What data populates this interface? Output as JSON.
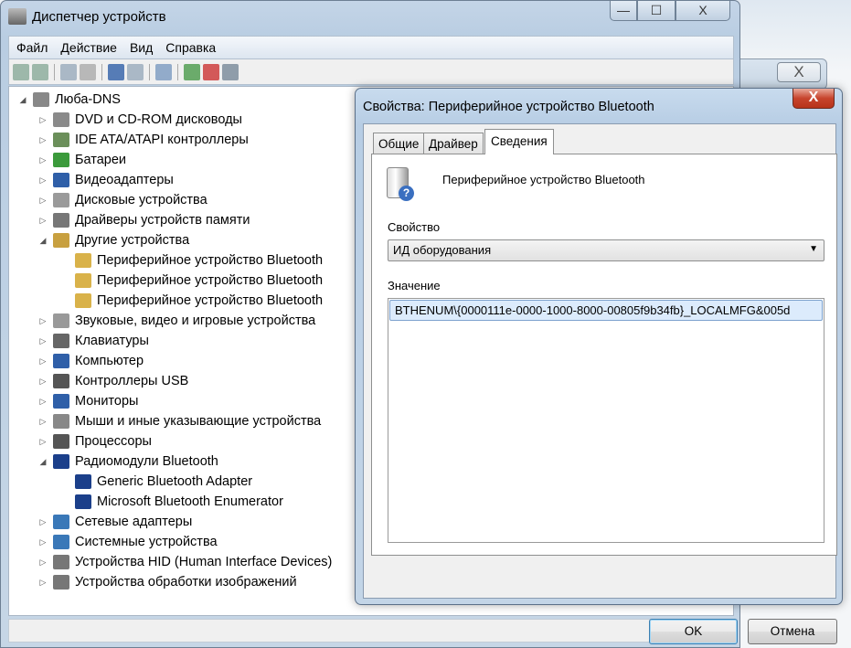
{
  "main_window": {
    "title": "Диспетчер устройств",
    "minimize": "—",
    "maximize": "☐",
    "close": "X"
  },
  "menu": [
    "Файл",
    "Действие",
    "Вид",
    "Справка"
  ],
  "toolbar": [
    "back-icon",
    "forward-icon",
    "show-hide-console-tree-icon",
    "properties-icon",
    "help-icon",
    "action-pane-icon",
    "scan-hardware-icon",
    "update-driver-icon",
    "uninstall-icon",
    "disable-icon"
  ],
  "background_window": {
    "close": "X"
  },
  "tree": {
    "root": "Люба-DNS",
    "items": [
      {
        "label": "DVD и CD-ROM дисководы",
        "expanded": false,
        "color": "#8a8a8a"
      },
      {
        "label": "IDE ATA/ATAPI контроллеры",
        "expanded": false,
        "color": "#6b8f5a"
      },
      {
        "label": "Батареи",
        "expanded": false,
        "color": "#3b9a3b"
      },
      {
        "label": "Видеоадаптеры",
        "expanded": false,
        "color": "#2f5fa8"
      },
      {
        "label": "Дисковые устройства",
        "expanded": false,
        "color": "#9a9a9a"
      },
      {
        "label": "Драйверы устройств памяти",
        "expanded": false,
        "color": "#777"
      },
      {
        "label": "Другие устройства",
        "expanded": true,
        "color": "#c8a040",
        "children": [
          "Периферийное устройство Bluetooth",
          "Периферийное устройство Bluetooth",
          "Периферийное устройство Bluetooth"
        ],
        "child_icon": "warning-device"
      },
      {
        "label": "Звуковые, видео и игровые устройства",
        "expanded": false,
        "color": "#999"
      },
      {
        "label": "Клавиатуры",
        "expanded": false,
        "color": "#666"
      },
      {
        "label": "Компьютер",
        "expanded": false,
        "color": "#2f5fa8"
      },
      {
        "label": "Контроллеры USB",
        "expanded": false,
        "color": "#555"
      },
      {
        "label": "Мониторы",
        "expanded": false,
        "color": "#2f5fa8"
      },
      {
        "label": "Мыши и иные указывающие устройства",
        "expanded": false,
        "color": "#888"
      },
      {
        "label": "Процессоры",
        "expanded": false,
        "color": "#555"
      },
      {
        "label": "Радиомодули Bluetooth",
        "expanded": true,
        "color": "#1b3f8a",
        "children": [
          "Generic Bluetooth Adapter",
          "Microsoft Bluetooth Enumerator"
        ],
        "child_icon": "bluetooth"
      },
      {
        "label": "Сетевые адаптеры",
        "expanded": false,
        "color": "#3a78b8"
      },
      {
        "label": "Системные устройства",
        "expanded": false,
        "color": "#3a78b8"
      },
      {
        "label": "Устройства HID (Human Interface Devices)",
        "expanded": false,
        "color": "#777"
      },
      {
        "label": "Устройства обработки изображений",
        "expanded": false,
        "color": "#777"
      }
    ]
  },
  "dialog": {
    "title": "Свойства: Периферийное устройство Bluetooth",
    "close": "X",
    "tabs": [
      "Общие",
      "Драйвер",
      "Сведения"
    ],
    "active_tab": "Сведения",
    "device_name": "Периферийное устройство Bluetooth",
    "property_label": "Свойство",
    "property_value": "ИД оборудования",
    "value_label": "Значение",
    "values": [
      "BTHENUM\\{0000111e-0000-1000-8000-00805f9b34fb}_LOCALMFG&005d"
    ],
    "ok": "OK",
    "cancel": "Отмена"
  }
}
